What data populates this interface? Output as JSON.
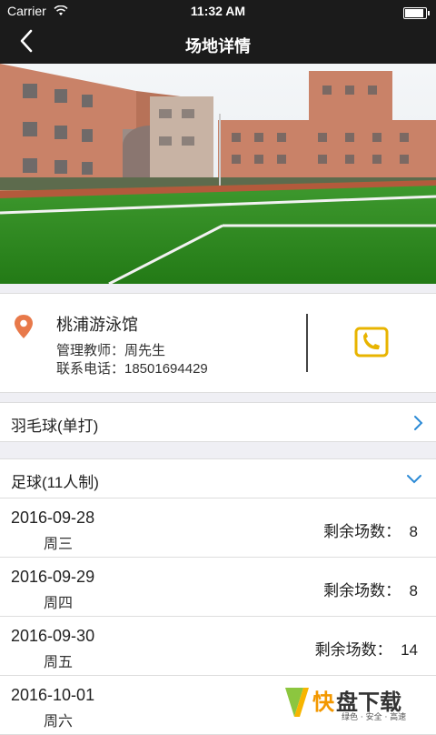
{
  "status_bar": {
    "carrier": "Carrier",
    "time": "11:32 AM",
    "battery_level": 0.9
  },
  "nav": {
    "title": "场地详情",
    "back_icon": "chevron-left-icon"
  },
  "venue": {
    "name": "桃浦游泳馆",
    "manager": "管理教师：周先生",
    "phone": "联系电话：18501694429",
    "accent_color": "#e8794a",
    "phone_icon_color": "#e8b400"
  },
  "sports": [
    {
      "label": "羽毛球(单打)",
      "state": "collapsed"
    },
    {
      "label": "足球(11人制)",
      "state": "expanded"
    }
  ],
  "schedule": [
    {
      "date": "2016-09-28",
      "weekday": "周三",
      "remaining": "剩余场数：  8"
    },
    {
      "date": "2016-09-29",
      "weekday": "周四",
      "remaining": "剩余场数：  8"
    },
    {
      "date": "2016-09-30",
      "weekday": "周五",
      "remaining": "剩余场数：  14"
    },
    {
      "date": "2016-10-01",
      "weekday": "周六",
      "remaining": ""
    }
  ],
  "watermark": {
    "main": "快盘下载",
    "sub": "绿色 · 安全 · 高速"
  }
}
